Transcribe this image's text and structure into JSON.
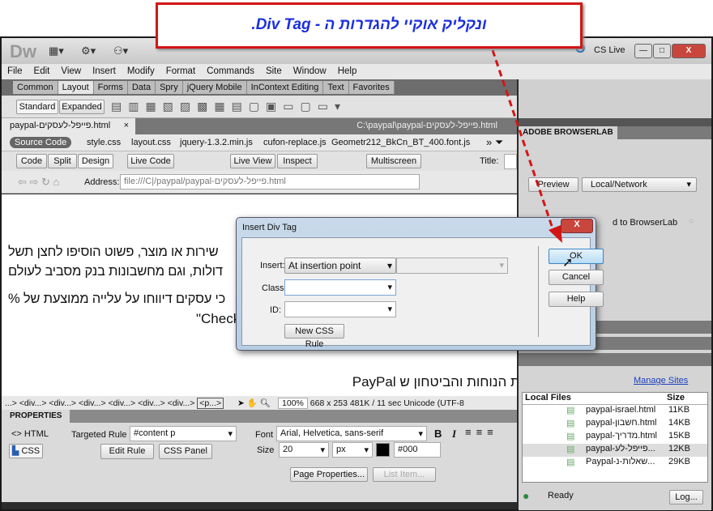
{
  "callout": {
    "text": "ונקליק אוקיי להגדרות ה - Div Tag."
  },
  "app": {
    "logo": "Dw",
    "cs_live": "CS Live",
    "minimize": "—",
    "restore": "□",
    "close": "X"
  },
  "menu": [
    "File",
    "Edit",
    "View",
    "Insert",
    "Modify",
    "Format",
    "Commands",
    "Site",
    "Window",
    "Help"
  ],
  "insert_tabs": [
    "Common",
    "Layout",
    "Forms",
    "Data",
    "Spry",
    "jQuery Mobile",
    "InContext Editing",
    "Text",
    "Favorites"
  ],
  "insert_bar": {
    "standard": "Standard",
    "expanded": "Expanded"
  },
  "doc_tab": {
    "name": "paypal-פייפל-לעסקים.html",
    "close": "×",
    "path": "C:\\paypal\\paypal-פייפל-לעסקים.html"
  },
  "related_files": {
    "source": "Source Code",
    "files": [
      "style.css",
      "layout.css",
      "jquery-1.3.2.min.js",
      "cufon-replace.js",
      "Geometr212_BkCn_BT_400.font.js"
    ]
  },
  "doc_toolbar": {
    "code": "Code",
    "split": "Split",
    "design": "Design",
    "live_code": "Live Code",
    "live_view": "Live View",
    "inspect": "Inspect",
    "multiscreen": "Multiscreen",
    "title_label": "Title:"
  },
  "address": {
    "label": "Address:",
    "value": "file:///C|/paypal/paypal-פייפל-לעסקים.html"
  },
  "content": {
    "lines": [
      "שירות או מוצר, פשוט הוסיפו לחצן תשל",
      "דולות, וגם מחשבונות בנק מסביב לעולם",
      "כי עסקים דיווחו על עלייה ממוצעת של %",
      "\"Check.",
      "מעדיפים את הנוחות והביטחון ש PayPal"
    ]
  },
  "tag_selector": {
    "path": "...> <div...> <div...> <div...> <div...> <div...> <div...>",
    "current": "<p...>",
    "zoom": "100%",
    "size": "668 x 253",
    "download": "481K / 11 sec",
    "encoding": "Unicode (UTF-8"
  },
  "properties": {
    "title": "PROPERTIES",
    "html": "HTML",
    "css": "CSS",
    "targeted_rule_label": "Targeted Rule",
    "targeted_rule": "#content p",
    "edit_rule": "Edit Rule",
    "css_panel": "CSS Panel",
    "font_label": "Font",
    "font": "Arial, Helvetica, sans-serif",
    "size_label": "Size",
    "size": "20",
    "unit": "px",
    "color": "#000",
    "page_properties": "Page Properties...",
    "list_item": "List Item..."
  },
  "browserlab": {
    "title": "ADOBE BROWSERLAB",
    "preview": "Preview",
    "source": "Local/Network",
    "sync": "d to BrowserLab"
  },
  "files": {
    "manage_sites": "Manage Sites",
    "col_local": "Local Files",
    "col_size": "Size",
    "rows": [
      {
        "name": "paypal-israel.html",
        "size": "11KB"
      },
      {
        "name": "paypal-חשבון.html",
        "size": "14KB"
      },
      {
        "name": "paypal-מדריך.html",
        "size": "15KB"
      },
      {
        "name": "paypal-פייפל-לע...",
        "size": "12KB"
      },
      {
        "name": "Paypal-שאלות-נ...",
        "size": "29KB"
      }
    ],
    "status": "Ready",
    "log": "Log..."
  },
  "dialog": {
    "title": "Insert Div Tag",
    "insert_label": "Insert:",
    "insert_value": "At insertion point",
    "class_label": "Class:",
    "id_label": "ID:",
    "new_css_rule": "New CSS Rule",
    "ok": "OK",
    "cancel": "Cancel",
    "help": "Help",
    "close": "X"
  }
}
